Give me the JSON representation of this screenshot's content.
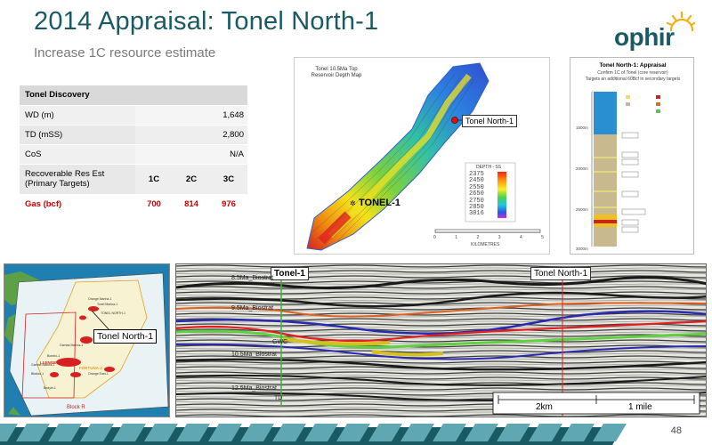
{
  "header": {
    "title": "2014 Appraisal: Tonel North-1",
    "subtitle": "Increase 1C resource estimate",
    "logo_text": "ophir"
  },
  "table": {
    "header": "Tonel Discovery",
    "rows": [
      {
        "label": "WD (m)",
        "value": "1,648"
      },
      {
        "label": "TD (mSS)",
        "value": "2,800"
      },
      {
        "label": "CoS",
        "value": "N/A"
      }
    ],
    "res_label": "Recoverable Res Est (Primary Targets)",
    "res_cols": [
      "1C",
      "2C",
      "3C"
    ],
    "gas_label": "Gas (bcf)",
    "gas_values": [
      "700",
      "814",
      "976"
    ]
  },
  "depth_map": {
    "title": "Tonel 10.5Ma Top Reservoir Depth Map",
    "label_north": "Tonel North-1",
    "label_tonel": "TONEL-1",
    "legend_title": "DEPTH - SS",
    "legend_values": [
      "2375",
      "2450",
      "2550",
      "2650",
      "2750",
      "2850",
      "3016"
    ],
    "scale_label": "KILOMETRES",
    "scale_ticks": [
      "0",
      "1",
      "2",
      "3",
      "4",
      "5"
    ]
  },
  "strat": {
    "title": "Tonel North-1: Appraisal",
    "line2": "Confirm 1C of Tonel (core reservoir)",
    "line3": "Targets an additional 60Bcf in secondary targets",
    "depths": [
      "1500m",
      "2000m",
      "2500m",
      "3000m"
    ]
  },
  "loc_map": {
    "callout": "Tonel North-1",
    "block_label": "Block R"
  },
  "seismic": {
    "well1": "Tonel-1",
    "well2": "Tonel North-1",
    "horizons": [
      "8.5Ma_Biostrat",
      "9.5Ma_Biostrat",
      "GWC",
      "10.5Ma_Biostrat",
      "12.5Ma_Biostrat",
      "TD"
    ],
    "scale_km": "2km",
    "scale_mile": "1 mile"
  },
  "footer": {
    "page": "48"
  },
  "colors": {
    "title": "#1a5a63",
    "gas": "#d00000",
    "band_dark": "#1a5a63",
    "band_light": "#5fa7b3"
  }
}
